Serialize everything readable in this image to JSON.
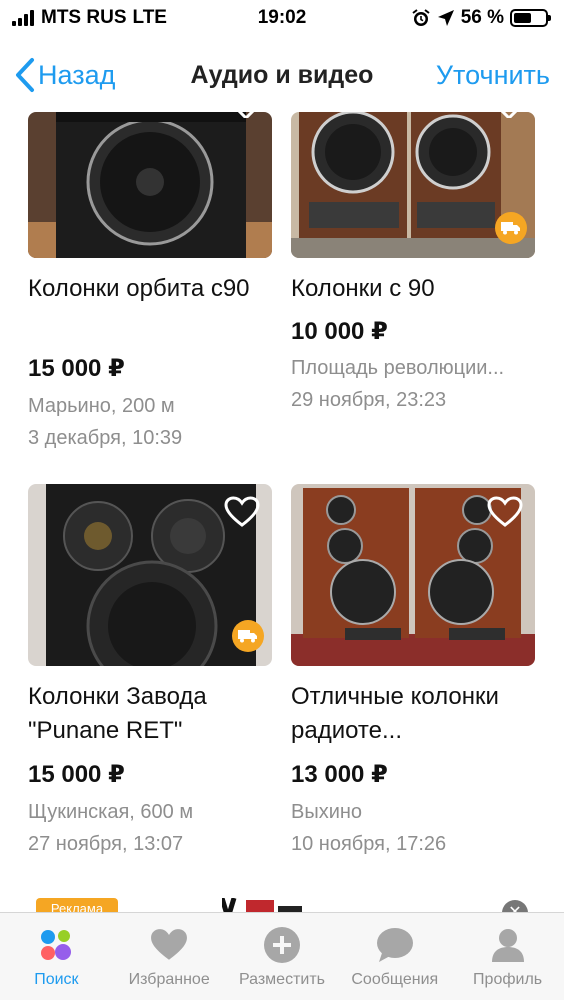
{
  "status": {
    "carrier": "MTS RUS",
    "network": "LTE",
    "time": "19:02",
    "battery": "56 %",
    "battery_level": 0.56
  },
  "nav": {
    "back_label": "Назад",
    "title": "Аудио и видео",
    "refine_label": "Уточнить"
  },
  "listings": [
    {
      "title": "Колонки орбита с90",
      "price": "15 000 ₽",
      "location": "Марьино,  200 м",
      "date": "3 декабря, 10:39",
      "delivery": false
    },
    {
      "title": "Колонки с 90",
      "price": "10 000 ₽",
      "location": "Площадь революции...",
      "date": "29 ноября, 23:23",
      "delivery": true
    },
    {
      "title": "Колонки Завода \"Punane RET\"",
      "price": "15 000 ₽",
      "location": "Щукинская,  600 м",
      "date": "27 ноября, 13:07",
      "delivery": true
    },
    {
      "title": "Отличные колонки радиоте...",
      "price": "13 000 ₽",
      "location": "Выхино",
      "date": "10 ноября, 17:26",
      "delivery": false
    }
  ],
  "ad": {
    "badge": "Реклама"
  },
  "tabs": [
    {
      "label": "Поиск",
      "icon": "search-dots-icon",
      "active": true
    },
    {
      "label": "Избранное",
      "icon": "heart-icon",
      "active": false
    },
    {
      "label": "Разместить",
      "icon": "plus-circle-icon",
      "active": false
    },
    {
      "label": "Сообщения",
      "icon": "chat-bubble-icon",
      "active": false
    },
    {
      "label": "Профиль",
      "icon": "person-icon",
      "active": false
    }
  ],
  "colors": {
    "accent": "#1e9bef",
    "delivery_badge": "#f5a623",
    "meta_text": "#8e8e8e"
  }
}
